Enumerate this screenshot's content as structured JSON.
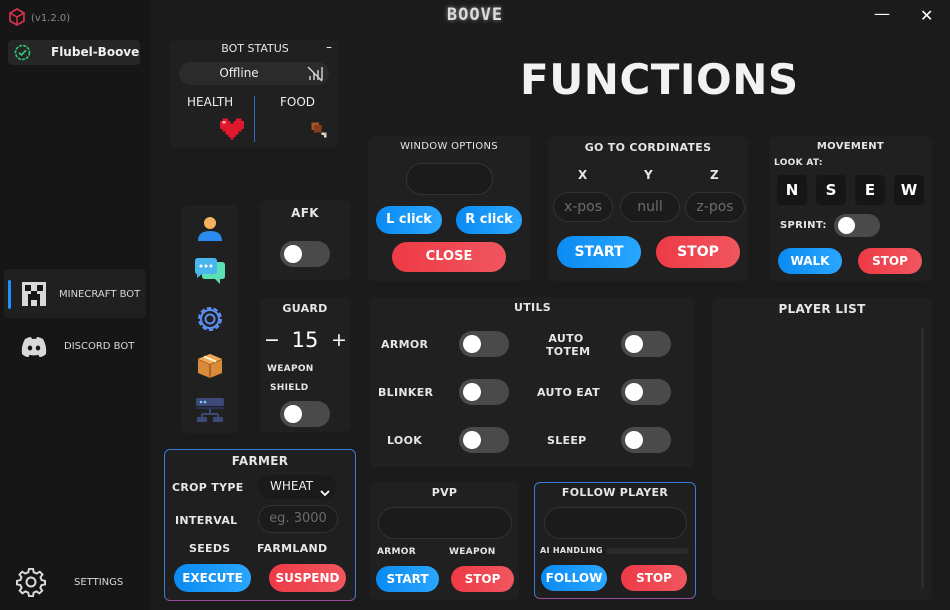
{
  "app": {
    "version": "(v1.2.0)",
    "title": "BOOVE"
  },
  "window": {
    "minimize": "—",
    "close": "✕"
  },
  "profile": {
    "name": "Flubel-Boove"
  },
  "sidebar": {
    "items": [
      {
        "label": "MINECRAFT BOT"
      },
      {
        "label": "DISCORD BOT"
      }
    ],
    "settings": "SETTINGS"
  },
  "bot_status": {
    "title": "BOT STATUS",
    "collapse": "–",
    "status": "Offline",
    "health": "HEALTH",
    "food": "FOOD"
  },
  "main_title": "FUNCTIONS",
  "window_options": {
    "title": "WINDOW OPTIONS",
    "left": "L click",
    "right": "R click",
    "close": "CLOSE"
  },
  "goto": {
    "title": "GO TO CORDINATES",
    "x": "X",
    "y": "Y",
    "z": "Z",
    "x_placeholder": "x-pos",
    "y_placeholder": "null",
    "z_placeholder": "z-pos",
    "start": "START",
    "stop": "STOP"
  },
  "movement": {
    "title": "MOVEMENT",
    "look_at": "LOOK AT:",
    "dirs": [
      "N",
      "S",
      "E",
      "W"
    ],
    "sprint": "SPRINT:",
    "walk": "WALK",
    "stop": "STOP"
  },
  "afk": {
    "title": "AFK"
  },
  "guard": {
    "title": "GUARD",
    "minus": "−",
    "value": "15",
    "plus": "+",
    "weapon": "WEAPON",
    "shield": "SHIELD"
  },
  "utils": {
    "title": "UTILS",
    "armor": "ARMOR",
    "auto_totem_1": "AUTO",
    "auto_totem_2": "TOTEM",
    "blinker": "BLINKER",
    "auto_eat": "AUTO EAT",
    "look": "LOOK",
    "sleep": "SLEEP"
  },
  "player_list": {
    "title": "PLAYER LIST"
  },
  "farmer": {
    "title": "FARMER",
    "crop_type": "CROP TYPE",
    "crop_value": "WHEAT",
    "interval": "INTERVAL",
    "interval_placeholder": "eg. 3000",
    "seeds": "SEEDS",
    "farmland": "FARMLAND",
    "execute": "EXECUTE",
    "suspend": "SUSPEND"
  },
  "pvp": {
    "title": "PVP",
    "armor": "ARMOR",
    "weapon": "WEAPON",
    "start": "START",
    "stop": "STOP"
  },
  "follow": {
    "title": "FOLLOW PLAYER",
    "ai_handling": "AI HANDLING",
    "follow": "FOLLOW",
    "stop": "STOP"
  },
  "colors": {
    "accent_blue": "#0a8bf2",
    "accent_red": "#ee3a46",
    "border_blue": "#3a7bd5",
    "online_green": "#2ecc71"
  }
}
